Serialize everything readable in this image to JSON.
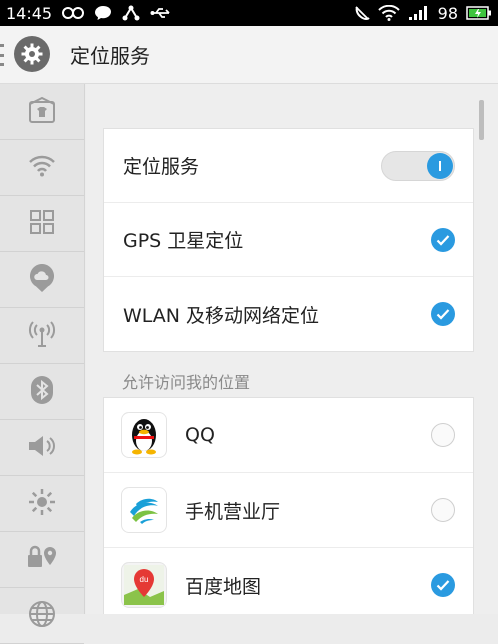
{
  "status_bar": {
    "time": "14:45",
    "battery": "98"
  },
  "header": {
    "title": "定位服务"
  },
  "sidebar": {
    "items": [
      {
        "icon": "shirt-icon"
      },
      {
        "icon": "wifi-icon"
      },
      {
        "icon": "grid-icon"
      },
      {
        "icon": "cloud-icon"
      },
      {
        "icon": "antenna-icon"
      },
      {
        "icon": "bluetooth-icon"
      },
      {
        "icon": "volume-icon"
      },
      {
        "icon": "brightness-icon"
      },
      {
        "icon": "location-lock-icon"
      },
      {
        "icon": "globe-icon"
      }
    ]
  },
  "settings": {
    "location_service_label": "定位服务",
    "location_service_on": true,
    "gps_label": "GPS 卫星定位",
    "gps_checked": true,
    "wlan_label": "WLAN 及移动网络定位",
    "wlan_checked": true
  },
  "apps_section": {
    "label": "允许访问我的位置",
    "apps": [
      {
        "name": "QQ",
        "checked": false,
        "icon": "qq-penguin-icon"
      },
      {
        "name": "手机营业厅",
        "checked": false,
        "icon": "china-mobile-icon"
      },
      {
        "name": "百度地图",
        "checked": true,
        "icon": "baidu-map-icon"
      }
    ]
  },
  "colors": {
    "accent": "#2a9ae0"
  }
}
